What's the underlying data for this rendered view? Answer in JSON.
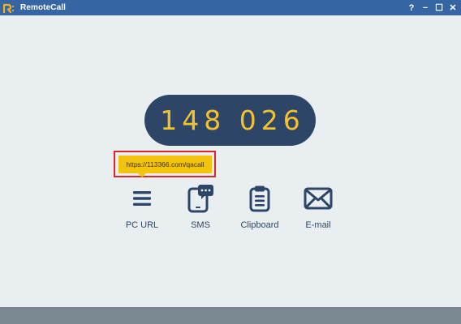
{
  "window": {
    "title": "RemoteCall",
    "controls": {
      "help": "?",
      "minimize": "−",
      "maximize": "☐",
      "close": "✕"
    },
    "accent_color": "#3565a2"
  },
  "connection_code": "148 026",
  "tooltip": {
    "text": "https://113366.com/qacall",
    "color": "#f2c40e",
    "highlight_color": "#e0242c"
  },
  "share_options": [
    {
      "label": "PC URL",
      "icon": "menu-icon"
    },
    {
      "label": "SMS",
      "icon": "sms-phone-icon"
    },
    {
      "label": "Clipboard",
      "icon": "clipboard-icon"
    },
    {
      "label": "E-mail",
      "icon": "envelope-icon"
    }
  ]
}
